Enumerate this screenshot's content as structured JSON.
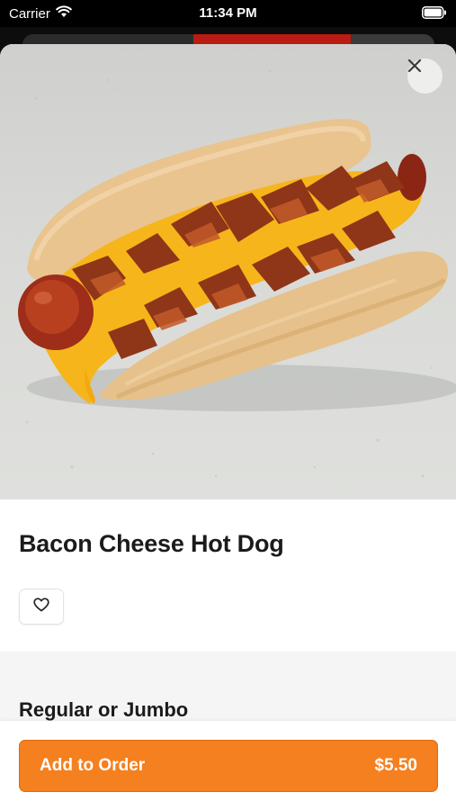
{
  "status_bar": {
    "carrier": "Carrier",
    "time": "11:34 PM"
  },
  "item": {
    "image_alt": "Bacon Cheese Hot Dog",
    "title": "Bacon Cheese Hot Dog"
  },
  "options": {
    "heading": "Regular or Jumbo"
  },
  "order": {
    "button_label": "Add to Order",
    "price": "$5.50"
  },
  "colors": {
    "accent": "#f5801f",
    "text": "#1b1b1b"
  },
  "icons": {
    "close": "close-icon",
    "favorite": "heart-icon",
    "wifi": "wifi-icon",
    "battery": "battery-icon"
  }
}
